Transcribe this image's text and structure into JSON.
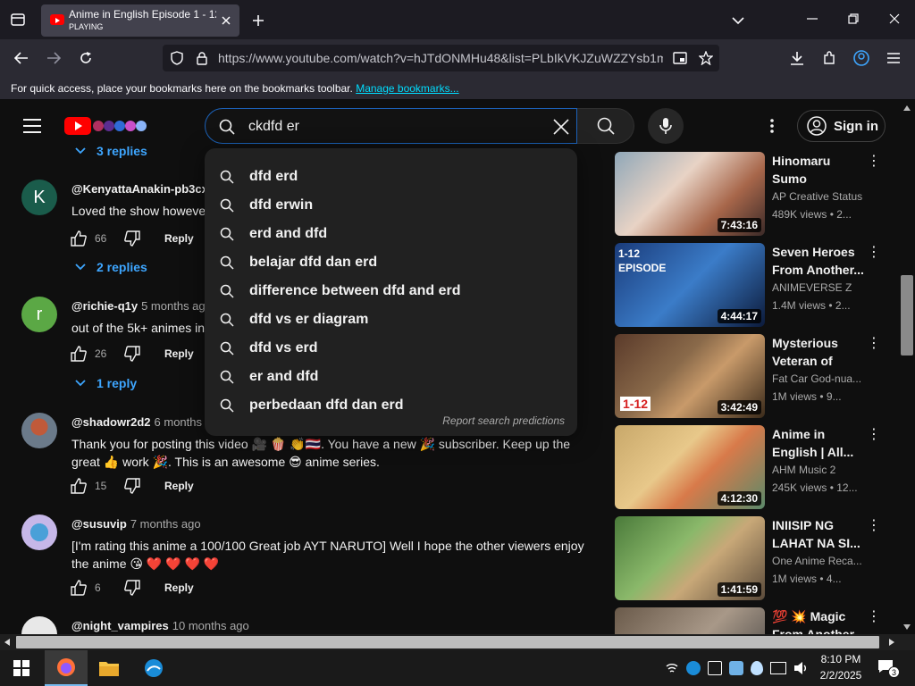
{
  "browser": {
    "tab_title": "Anime in English Episode 1 - 12",
    "tab_status": "PLAYING",
    "url": "https://www.youtube.com/watch?v=hJTdONMHu48&list=PLbIkVKJZuWZZYsb1m",
    "bookmarks_text": "For quick access, place your bookmarks here on the bookmarks toolbar.",
    "bookmarks_link": "Manage bookmarks..."
  },
  "youtube": {
    "search_query": "ckdfd er",
    "sign_in_label": "Sign in",
    "suggestions": [
      "dfd erd",
      "dfd erwin",
      "erd and dfd",
      "belajar dfd dan erd",
      "difference between dfd and erd",
      "dfd vs er diagram",
      "dfd vs erd",
      "er and dfd",
      "perbedaan dfd dan erd"
    ],
    "report_label": "Report search predictions"
  },
  "comments": {
    "top_replies": "3 replies",
    "items": [
      {
        "avatar_letter": "K",
        "author": "@KenyattaAnakin-pb3cx",
        "time": "",
        "text": "Loved the show howeve",
        "likes": "66",
        "reply_label": "Reply",
        "replies": "2 replies"
      },
      {
        "avatar_letter": "r",
        "author": "@richie-q1y",
        "time": "5 months ago",
        "text": "out of the 5k+ animes in",
        "likes": "26",
        "reply_label": "Reply",
        "replies": "1 reply"
      },
      {
        "avatar_letter": "",
        "author": "@shadowr2d2",
        "time": "6 months a",
        "text": "Thank you for posting this video 🎥 🍿 👏🇹🇭.  You have a new 🎉 subscriber.  Keep up the great 👍 work 🎉.  This is an awesome 😎 anime series.",
        "likes": "15",
        "reply_label": "Reply",
        "replies": ""
      },
      {
        "avatar_letter": "",
        "author": "@susuvip",
        "time": "7 months ago",
        "text": "[I'm rating this anime a 100/100 Great job AYT NARUTO] Well I hope the other viewers enjoy the anime 😘 ❤️ ❤️ ❤️ ❤️",
        "likes": "6",
        "reply_label": "Reply",
        "replies": ""
      },
      {
        "avatar_letter": "",
        "author": "@night_vampires",
        "time": "10 months ago",
        "text": "",
        "likes": "",
        "reply_label": "",
        "replies": ""
      }
    ]
  },
  "sidebar_videos": [
    {
      "title": "Hinomaru Sumo Episode...",
      "channel": "AP Creative Status",
      "views": "489K views",
      "age": "• 2...",
      "duration": "7:43:16",
      "overlay": ""
    },
    {
      "title": "Seven Heroes From Another...",
      "channel": "ANIMEVERSE Z",
      "views": "1.4M views",
      "age": "• 2...",
      "duration": "4:44:17",
      "overlay": "1-12 EPISODE"
    },
    {
      "title": "Mysterious Veteran of the...",
      "channel": "Fat Car God-nua...",
      "views": "1M views",
      "age": "• 9...",
      "duration": "3:42:49",
      "overlay": "1-12"
    },
    {
      "title": "Anime in English | All...",
      "channel": "AHM Music 2",
      "views": "245K views",
      "age": "• 12...",
      "duration": "4:12:30",
      "overlay": ""
    },
    {
      "title": "INIISIP NG LAHAT NA SI...",
      "channel": "One Anime Reca...",
      "views": "1M views",
      "age": "• 4...",
      "duration": "1:41:59",
      "overlay": ""
    },
    {
      "title": "💯 💥 Magic From Another...",
      "channel": "",
      "views": "",
      "age": "",
      "duration": "",
      "overlay": ""
    }
  ],
  "taskbar": {
    "time": "8:10 PM",
    "date": "2/2/2025",
    "notification_count": "3"
  }
}
